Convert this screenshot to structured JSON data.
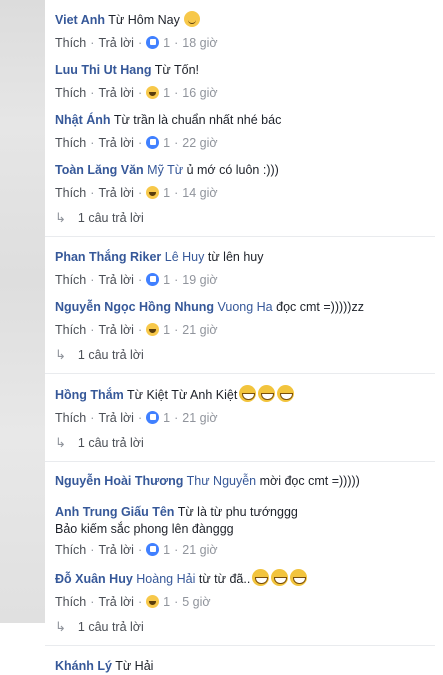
{
  "labels": {
    "like": "Thích",
    "reply": "Trả lời",
    "sep": "·"
  },
  "c1": {
    "author": "Viet Anh",
    "text": "Từ Hôm Nay",
    "count": "1",
    "time": "18 giờ"
  },
  "c2": {
    "author": "Luu Thi Ut Hang",
    "text": "Từ Tốn!",
    "count": "1",
    "time": "16 giờ"
  },
  "c3": {
    "author": "Nhật Ánh",
    "text": "Từ trần là chuẩn nhất nhé bác",
    "count": "1",
    "time": "22 giờ"
  },
  "c4": {
    "author": "Toàn Lăng Văn",
    "mention": "Mỹ Từ",
    "text": "ủ mớ có luôn :)))",
    "count": "1",
    "time": "14 giờ",
    "replies": "1 câu trả lời"
  },
  "c5": {
    "author": "Phan Thắng Riker",
    "mention": "Lê Huy",
    "text": "từ lên huy",
    "count": "1",
    "time": "19 giờ"
  },
  "c6": {
    "author": "Nguyễn Ngọc Hồng Nhung",
    "mention": "Vuong Ha",
    "text": "đọc cmt =)))))zz",
    "count": "1",
    "time": "21 giờ",
    "replies": "1 câu trả lời"
  },
  "c7": {
    "author": "Hồng Thắm",
    "text": "Từ Kiệt Từ Anh Kiệt",
    "count": "1",
    "time": "21 giờ",
    "replies": "1 câu trả lời"
  },
  "c8": {
    "author": "Nguyễn Hoài Thương",
    "mention": "Thư Nguyễn",
    "text": "mời đọc cmt =)))))"
  },
  "c9": {
    "author": "Anh Trung Giấu Tên",
    "text": "Từ là từ phu tướnggg",
    "text2": "Bảo kiếm sắc phong lên đànggg",
    "count": "1",
    "time": "21 giờ"
  },
  "c10": {
    "author": "Đỗ Xuân Huy",
    "mention": "Hoàng Hải",
    "text": "từ từ đã..",
    "count": "1",
    "time": "5 giờ",
    "replies": "1 câu trả lời"
  },
  "c11": {
    "author": "Khánh Lý",
    "text": "Từ Hải"
  }
}
